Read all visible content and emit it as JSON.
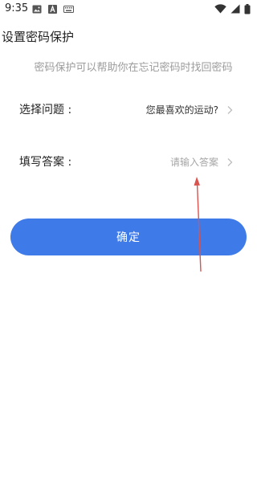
{
  "status_bar": {
    "time": "9:35",
    "left_icons": [
      "image-icon",
      "font-a-icon",
      "keyboard-icon"
    ],
    "right_icons": [
      "wifi-icon",
      "signal-icon",
      "battery-icon"
    ]
  },
  "page": {
    "title": "设置密码保护",
    "subtitle": "密码保护可以帮助你在忘记密码时找回密码"
  },
  "form": {
    "question_label": "选择问题 :",
    "question_value": "您最喜欢的运动?",
    "answer_label": "填写答案 :",
    "answer_placeholder": "请输入答案"
  },
  "actions": {
    "confirm_label": "确定"
  },
  "colors": {
    "primary": "#3f7ae9",
    "annotation": "#d9534f"
  }
}
